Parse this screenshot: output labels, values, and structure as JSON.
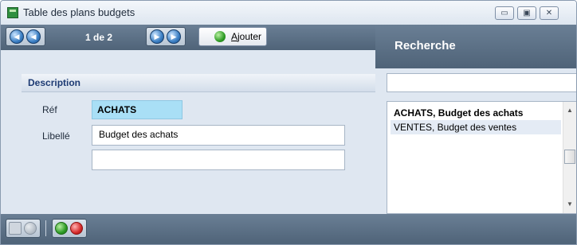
{
  "window": {
    "title": "Table des plans budgets",
    "controls": {
      "minimize": "▭",
      "maximize": "▣",
      "close": "✕"
    }
  },
  "toolbar": {
    "record_counter": "1 de 2",
    "add_label": "Ajouter",
    "search_title": "Recherche"
  },
  "description": {
    "header": "Description",
    "ref_label": "Réf",
    "ref_value": "ACHATS",
    "libelle_label": "Libellé",
    "libelle_value": "Budget des achats",
    "extra_value": ""
  },
  "search": {
    "query": "",
    "results": [
      {
        "text": "ACHATS, Budget des achats",
        "selected": true
      },
      {
        "text": "VENTES, Budget des ventes",
        "selected": false
      }
    ]
  },
  "colors": {
    "toolbar": "#5b6f85",
    "ref_highlight": "#a9dff6",
    "heading": "#1c3a73"
  },
  "icons": {
    "nav_first": "first-record-icon",
    "nav_prev": "previous-record-icon",
    "nav_next": "next-record-icon",
    "nav_last": "last-record-icon",
    "add": "add-green-icon",
    "save": "save-icon",
    "cancel": "cancel-icon",
    "new": "new-green-icon",
    "delete": "delete-red-icon"
  }
}
